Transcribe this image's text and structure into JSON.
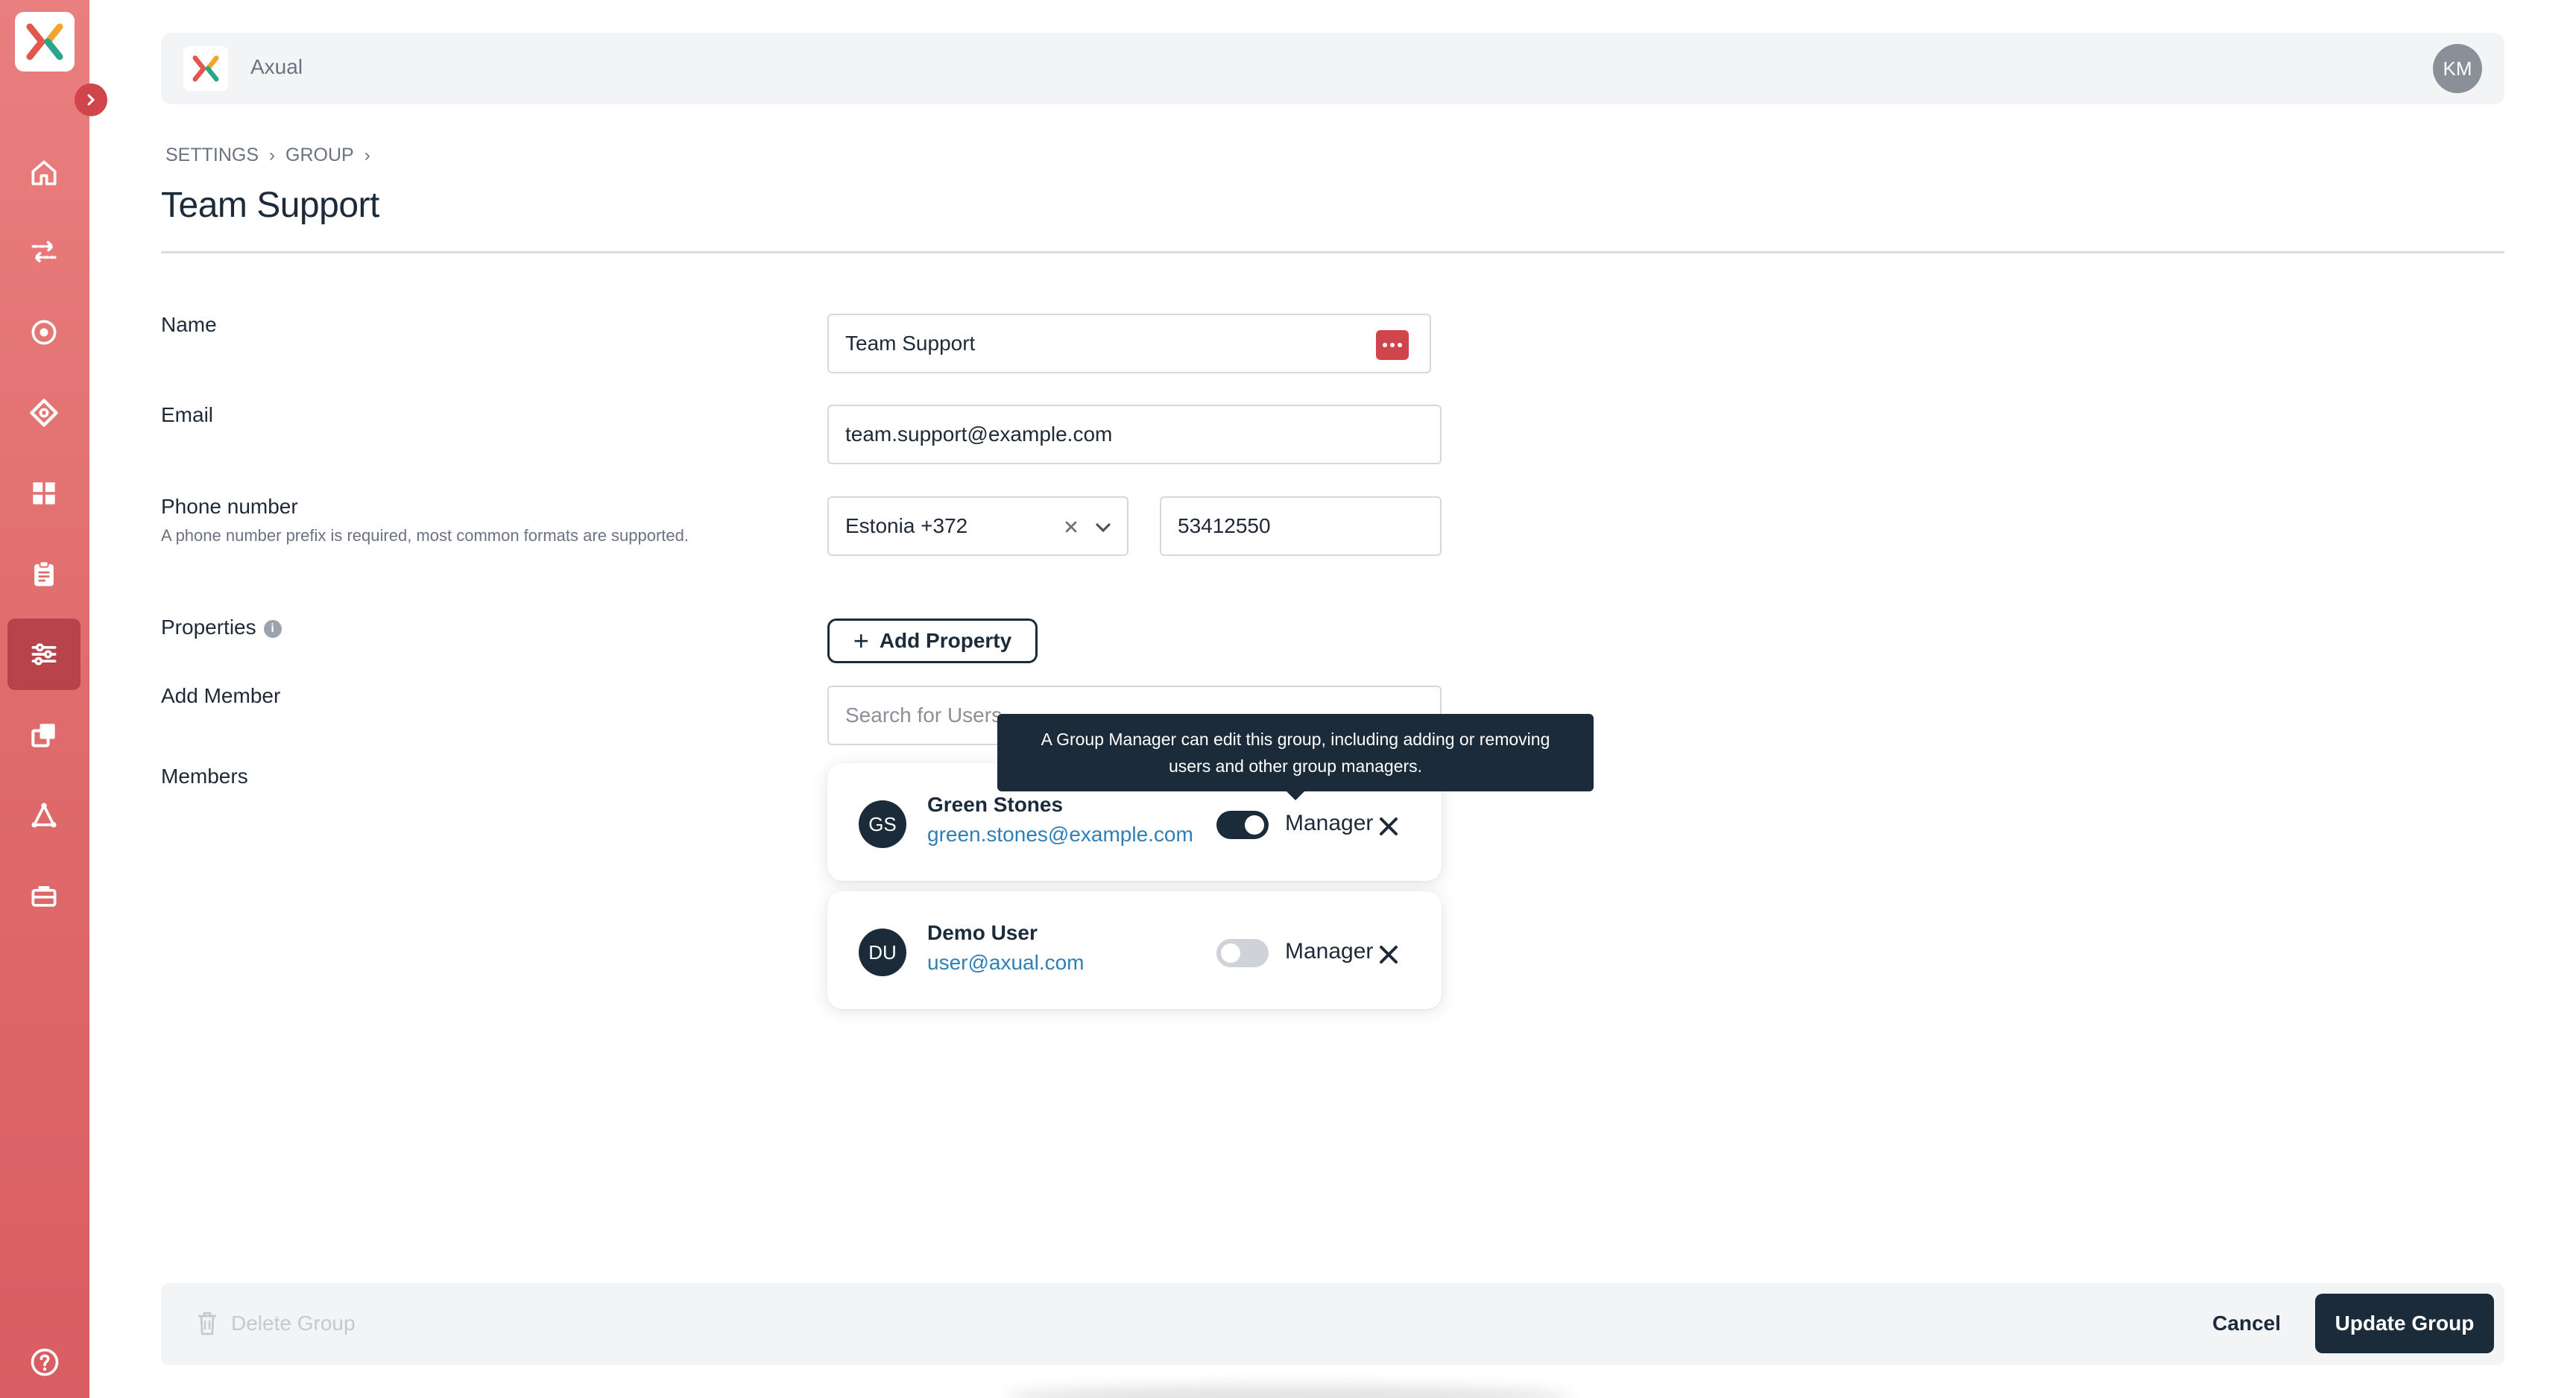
{
  "app": {
    "name": "Axual",
    "user_initials": "KM"
  },
  "breadcrumb": [
    "SETTINGS",
    "GROUP"
  ],
  "page_title": "Team Support",
  "form": {
    "name_label": "Name",
    "name_value": "Team Support",
    "email_label": "Email",
    "email_value": "team.support@example.com",
    "phone_label": "Phone number",
    "phone_help": "A phone number prefix is required, most common formats are supported.",
    "phone_country": "Estonia +372",
    "phone_number": "53412550",
    "properties_label": "Properties",
    "add_property_label": "Add Property",
    "add_member_label": "Add Member",
    "search_placeholder": "Search for Users",
    "members_label": "Members"
  },
  "members": [
    {
      "initials": "GS",
      "name": "Green Stones",
      "email": "green.stones@example.com",
      "role": "Manager",
      "manager": true
    },
    {
      "initials": "DU",
      "name": "Demo User",
      "email": "user@axual.com",
      "role": "Manager",
      "manager": false
    }
  ],
  "tooltip": {
    "line1": "A Group Manager can edit this group, including adding or removing",
    "line2": "users and other group managers."
  },
  "footer": {
    "delete_label": "Delete Group",
    "cancel_label": "Cancel",
    "update_label": "Update Group"
  },
  "colors": {
    "brand": "#d0454b",
    "navy": "#1c2b3a",
    "link": "#2f7fb6"
  },
  "icons": [
    "home-icon",
    "transfer-icon",
    "target-icon",
    "diamond-icon",
    "grid-icon",
    "clipboard-icon",
    "sliders-icon",
    "copy-icon",
    "network-icon",
    "briefcase-icon",
    "help-icon"
  ]
}
